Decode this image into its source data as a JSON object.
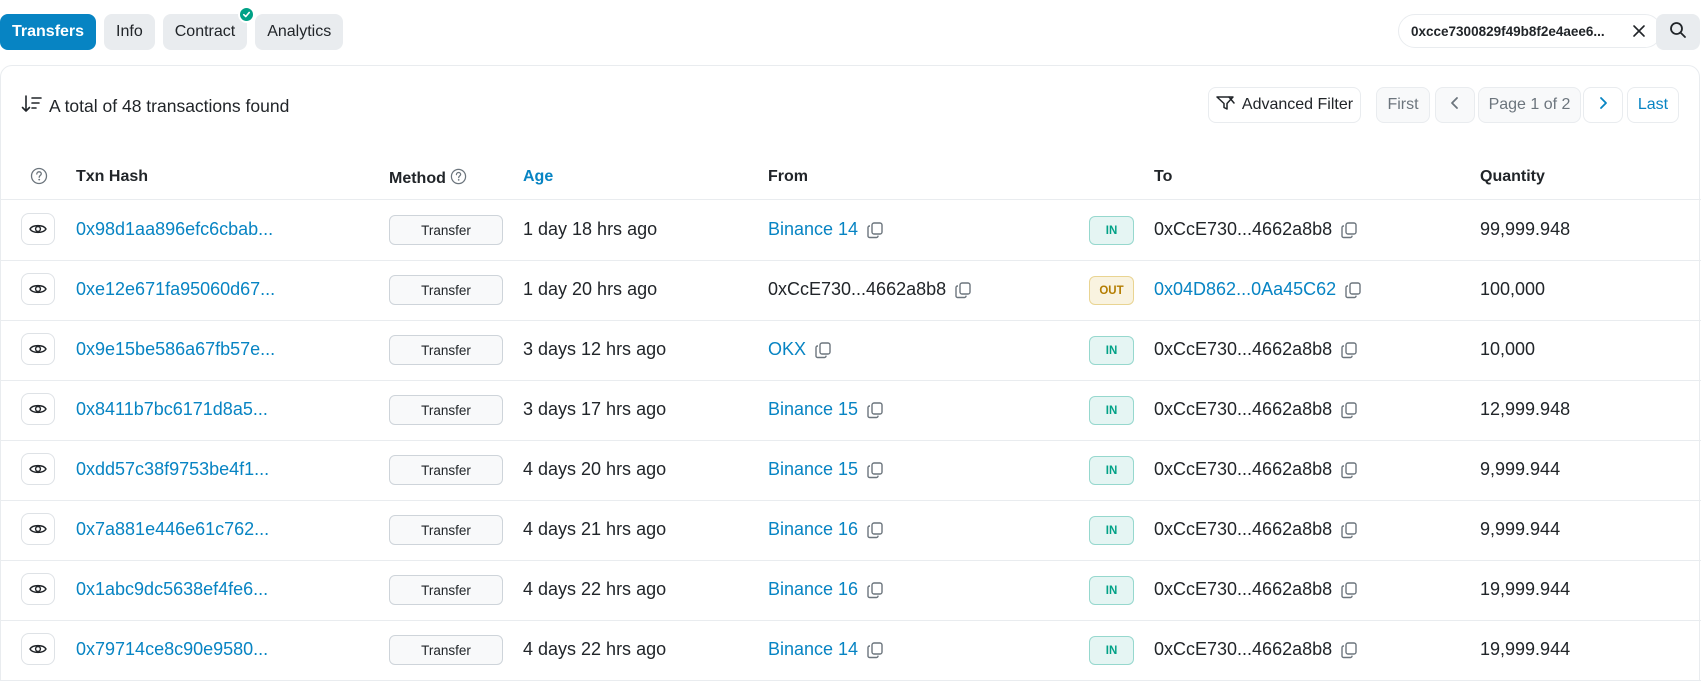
{
  "tabs": [
    {
      "label": "Transfers"
    },
    {
      "label": "Info"
    },
    {
      "label": "Contract"
    },
    {
      "label": "Analytics"
    }
  ],
  "search": {
    "address": "0xcce7300829f49b8f2e4aee6..."
  },
  "summary": {
    "text": "A total of 48 transactions found"
  },
  "toolbar": {
    "advanced_filter": "Advanced Filter",
    "first": "First",
    "page_info": "Page 1 of 2",
    "last": "Last"
  },
  "table": {
    "headers": {
      "txn_hash": "Txn Hash",
      "method": "Method",
      "age": "Age",
      "from": "From",
      "to": "To",
      "quantity": "Quantity"
    },
    "rows": [
      {
        "hash": "0x98d1aa896efc6cbab...",
        "method": "Transfer",
        "age": "1 day 18 hrs ago",
        "from": "Binance 14",
        "from_link": true,
        "direction": "IN",
        "to": "0xCcE730...4662a8b8",
        "to_link": false,
        "quantity": "99,999.948"
      },
      {
        "hash": "0xe12e671fa95060d67...",
        "method": "Transfer",
        "age": "1 day 20 hrs ago",
        "from": "0xCcE730...4662a8b8",
        "from_link": false,
        "direction": "OUT",
        "to": "0x04D862...0Aa45C62",
        "to_link": true,
        "quantity": "100,000"
      },
      {
        "hash": "0x9e15be586a67fb57e...",
        "method": "Transfer",
        "age": "3 days 12 hrs ago",
        "from": "OKX",
        "from_link": true,
        "direction": "IN",
        "to": "0xCcE730...4662a8b8",
        "to_link": false,
        "quantity": "10,000"
      },
      {
        "hash": "0x8411b7bc6171d8a5...",
        "method": "Transfer",
        "age": "3 days 17 hrs ago",
        "from": "Binance 15",
        "from_link": true,
        "direction": "IN",
        "to": "0xCcE730...4662a8b8",
        "to_link": false,
        "quantity": "12,999.948"
      },
      {
        "hash": "0xdd57c38f9753be4f1...",
        "method": "Transfer",
        "age": "4 days 20 hrs ago",
        "from": "Binance 15",
        "from_link": true,
        "direction": "IN",
        "to": "0xCcE730...4662a8b8",
        "to_link": false,
        "quantity": "9,999.944"
      },
      {
        "hash": "0x7a881e446e61c762...",
        "method": "Transfer",
        "age": "4 days 21 hrs ago",
        "from": "Binance 16",
        "from_link": true,
        "direction": "IN",
        "to": "0xCcE730...4662a8b8",
        "to_link": false,
        "quantity": "9,999.944"
      },
      {
        "hash": "0x1abc9dc5638ef4fe6...",
        "method": "Transfer",
        "age": "4 days 22 hrs ago",
        "from": "Binance 16",
        "from_link": true,
        "direction": "IN",
        "to": "0xCcE730...4662a8b8",
        "to_link": false,
        "quantity": "19,999.944"
      },
      {
        "hash": "0x79714ce8c90e9580...",
        "method": "Transfer",
        "age": "4 days 22 hrs ago",
        "from": "Binance 14",
        "from_link": true,
        "direction": "IN",
        "to": "0xCcE730...4662a8b8",
        "to_link": false,
        "quantity": "19,999.944"
      }
    ]
  },
  "colors": {
    "accent": "#0784c3",
    "in": "#00a186",
    "out": "#b47d00",
    "verified": "#00a186"
  },
  "icons": [
    "check-icon",
    "close-icon",
    "search-icon",
    "sort-icon",
    "filter-icon",
    "chevron-left-icon",
    "chevron-right-icon",
    "help-icon",
    "eye-icon",
    "copy-icon"
  ]
}
